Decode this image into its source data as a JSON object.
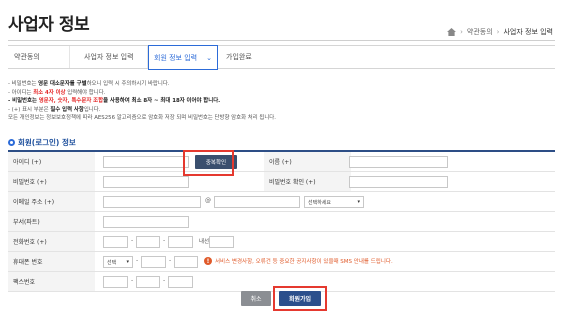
{
  "page": {
    "title": "사업자 정보",
    "breadcrumb": [
      "약관동의",
      "사업자 정보 입력"
    ]
  },
  "steps": [
    {
      "label": "약관동의"
    },
    {
      "label": "사업자 정보 입력"
    },
    {
      "label": "회원 정보 입력",
      "active": true
    },
    {
      "label": "가입완료"
    }
  ],
  "notes": {
    "line1_pre": "- 비밀번호는 ",
    "line1_bold": "영문 대소문자를 구별",
    "line1_post": "하오니 입력 시 주의하시기 바랍니다.",
    "line2_pre": "- 아이디는 ",
    "line2_red": "최소 4자 이상",
    "line2_post": " 입력해야 합니다.",
    "line3_bold1": "- 비밀번호는 ",
    "line3_red": "영문자, 숫자, 특수문자 조합",
    "line3_bold2": "을 사용하여 최소 8자 ~ 최대 18자 이어야 합니다.",
    "line4_pre": "- (+) 표시 부분은 ",
    "line4_bold": "필수 입력 사항",
    "line4_post": "입니다.",
    "line5": "모든 개인정보는 정보보호정책에 따라 AES256 알고리즘으로 암호화 저장 되며 비밀번호는 단방향 암호화 처리 됩니다."
  },
  "section": {
    "title": "회원(로그인) 정보"
  },
  "form": {
    "id_label": "아이디 (+)",
    "dup_check_label": "중복확인",
    "name_label": "이름 (+)",
    "password_label": "비밀번호 (+)",
    "password_confirm_label": "비밀번호 확인 (+)",
    "email_label": "이메일 주소 (+)",
    "email_at": "@",
    "email_domain_select": "선택하세요",
    "department_label": "부서(파트)",
    "phone_label": "전화번호 (+)",
    "phone_ext_label": "내선",
    "mobile_label": "휴대폰 번호",
    "mobile_select": "선택",
    "mobile_notice": "서비스 변경사항, 오류건 등 중요한 공지사항이 있을때 SMS 안내를 드립니다.",
    "fax_label": "팩스번호",
    "dash": "-"
  },
  "actions": {
    "cancel_label": "취소",
    "join_label": "회원가입"
  },
  "colors": {
    "accent": "#2c6bd8",
    "primary_button": "#2b4f8c",
    "highlight": "#e5392f",
    "required_red": "#e52a2a"
  }
}
